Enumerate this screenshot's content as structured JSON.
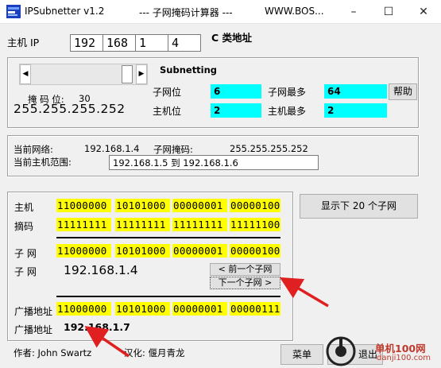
{
  "window": {
    "app_name": "IPSubnetter v1.2",
    "caption": "--- 子网掩码计算器 ---",
    "url_fragment": "WWW.BOS..."
  },
  "host_ip": {
    "label": "主机 IP",
    "octets": [
      "192",
      "168",
      "1",
      "4"
    ],
    "class_label": "C 类地址"
  },
  "subnetting": {
    "title": "Subnetting",
    "mask_bits_label": "掩 码 位:",
    "mask_bits_value": "30",
    "mask_text": "255.255.255.252",
    "slider_fraction": 0.97,
    "subnet_bits_label": "子网位",
    "subnet_bits_value": "6",
    "max_subnets_label": "子网最多",
    "max_subnets_value": "64",
    "host_bits_label": "主机位",
    "host_bits_value": "2",
    "max_hosts_label": "主机最多",
    "max_hosts_value": "2",
    "help_label": "帮助"
  },
  "current": {
    "network_label": "当前网络:",
    "network_value": "192.168.1.4",
    "mask_label": "子网掩码:",
    "mask_value": "255.255.255.252",
    "range_label": "当前主机范围:",
    "range_value": "192.168.1.5 到 192.168.1.6"
  },
  "binary": {
    "host_label": "主机",
    "host_bits": [
      "11000000",
      "10101000",
      "00000001",
      "00000100"
    ],
    "mask_label": "摘码",
    "mask_bits": [
      "11111111",
      "11111111",
      "11111111",
      "11111100"
    ],
    "subnet_label": "子 网",
    "subnet_bits": [
      "11000000",
      "10101000",
      "00000001",
      "00000100"
    ],
    "subnet_label2": "子 网",
    "subnet_ip": "192.168.1.4",
    "prev_label": "< 前一个子网",
    "next_label": "下一个子网 >",
    "broadcast_label": "广播地址",
    "broadcast_bits": [
      "11000000",
      "10101000",
      "00000001",
      "00000111"
    ],
    "broadcast_label2": "广播地址",
    "broadcast_ip": "192.168.1.7"
  },
  "show_next_label": "显示下 20 个子网",
  "footer": {
    "author": "作者: John Swartz",
    "localizer": "汉化: 偃月青龙",
    "menu_label": "菜单",
    "exit_label": "退出"
  },
  "watermark": {
    "text": "单机100网",
    "sub": "danji100.com"
  },
  "colors": {
    "cyan_field": "#00ffff",
    "binary_field": "#ffff00",
    "annotation_arrow": "#e02020"
  }
}
